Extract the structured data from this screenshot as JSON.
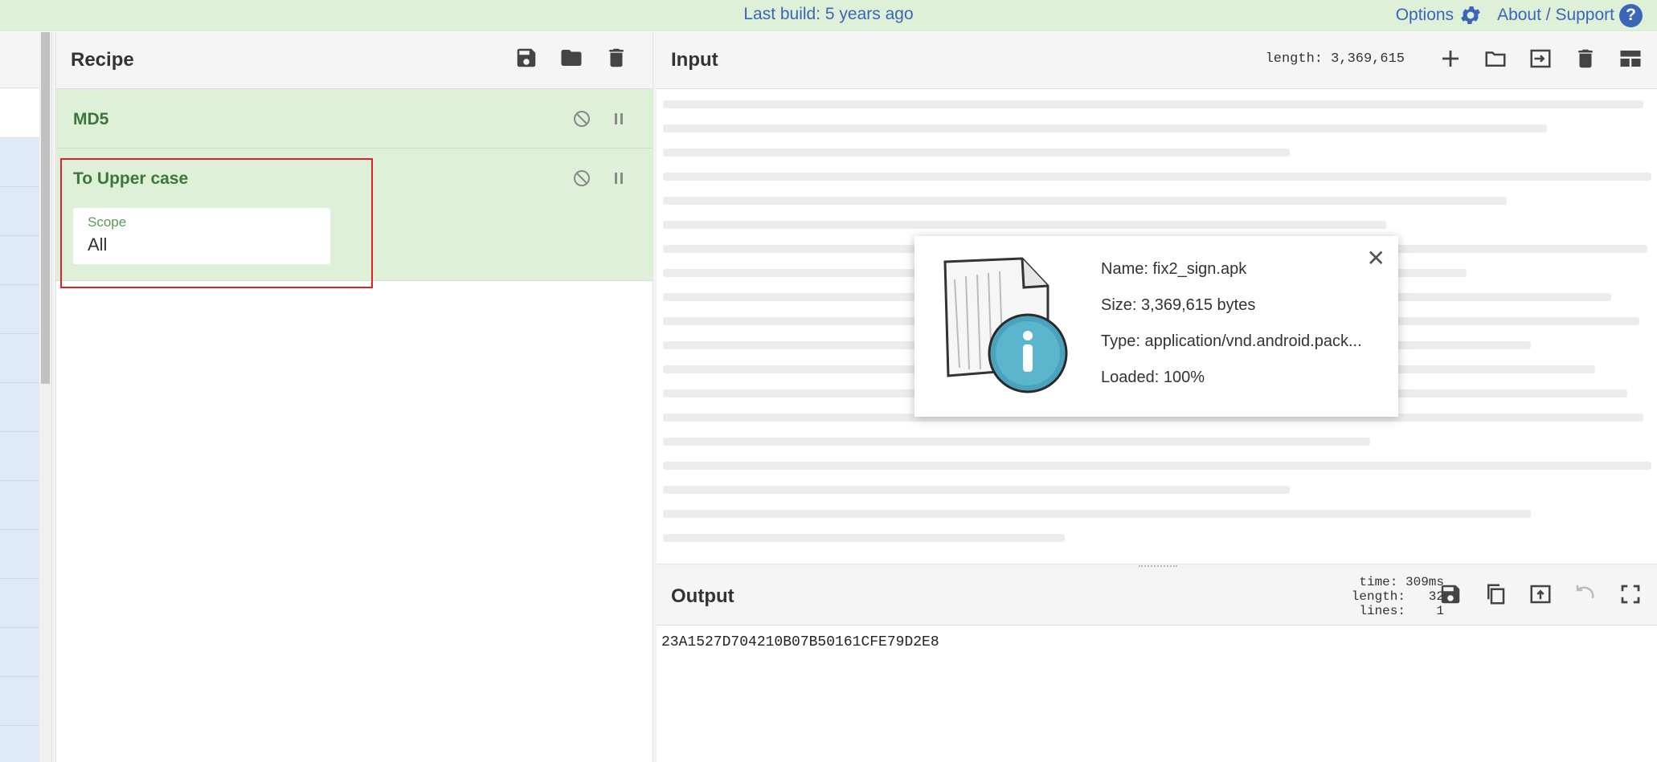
{
  "banner": {
    "build_text": "Last build: 5 years ago",
    "options_label": "Options",
    "about_label": "About / Support",
    "help_glyph": "?"
  },
  "recipe": {
    "title": "Recipe",
    "icons": [
      "save-icon",
      "folder-open-icon",
      "trash-icon"
    ],
    "operations": [
      {
        "name": "MD5",
        "controls": [
          "disable-icon",
          "breakpoint-icon"
        ]
      },
      {
        "name": "To Upper case",
        "controls": [
          "disable-icon",
          "breakpoint-icon"
        ],
        "args": [
          {
            "label": "Scope",
            "value": "All"
          }
        ]
      }
    ]
  },
  "input": {
    "title": "Input",
    "length": "length: 3,369,615",
    "icons": [
      "plus-icon",
      "folder-icon",
      "import-icon",
      "trash-icon",
      "layout-icon"
    ]
  },
  "file_info": {
    "name": "Name: fix2_sign.apk",
    "size": "Size: 3,369,615 bytes",
    "type": "Type: application/vnd.android.pack...",
    "loaded": "Loaded: 100%",
    "close_glyph": "✕"
  },
  "output": {
    "title": "Output",
    "time": "time: 309ms",
    "length": "length:   32",
    "lines": "lines:    1",
    "value": "23A1527D704210B07B50161CFE79D2E8",
    "icons": [
      "save-icon",
      "copy-icon",
      "replace-input-icon",
      "undo-icon",
      "maximise-icon"
    ]
  },
  "colors": {
    "banner_bg": "#dff0d8",
    "link": "#3a66b8",
    "op_bg": "#dff0d8",
    "op_text": "#3c763d",
    "highlight": "#e0202a"
  }
}
